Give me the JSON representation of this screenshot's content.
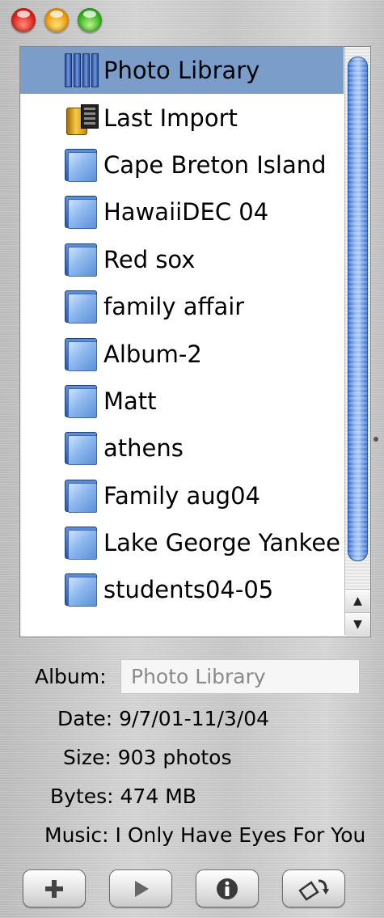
{
  "window": {
    "controls": [
      "close",
      "minimize",
      "zoom"
    ]
  },
  "albums": {
    "items": [
      {
        "label": "Photo Library",
        "icon": "photo-library-icon",
        "selected": true
      },
      {
        "label": "Last Import",
        "icon": "last-import-icon",
        "selected": false
      },
      {
        "label": "Cape Breton Island",
        "icon": "album-folder-icon",
        "selected": false
      },
      {
        "label": "HawaiiDEC 04",
        "icon": "album-folder-icon",
        "selected": false
      },
      {
        "label": "Red sox",
        "icon": "album-folder-icon",
        "selected": false
      },
      {
        "label": "family affair",
        "icon": "album-folder-icon",
        "selected": false
      },
      {
        "label": "Album-2",
        "icon": "album-folder-icon",
        "selected": false
      },
      {
        "label": "Matt",
        "icon": "album-folder-icon",
        "selected": false
      },
      {
        "label": "athens",
        "icon": "album-folder-icon",
        "selected": false
      },
      {
        "label": "Family aug04",
        "icon": "album-folder-icon",
        "selected": false
      },
      {
        "label": "Lake George Yankee",
        "icon": "album-folder-icon",
        "selected": false
      },
      {
        "label": "students04-05",
        "icon": "album-folder-icon",
        "selected": false
      }
    ]
  },
  "info": {
    "album_label": "Album:",
    "album_value": "Photo Library",
    "date_label": "Date:",
    "date_value": "9/7/01-11/3/04",
    "size_label": "Size:",
    "size_value": "903 photos",
    "bytes_label": "Bytes:",
    "bytes_value": "474 MB",
    "music_label": "Music:",
    "music_value": "I Only Have Eyes For You"
  },
  "buttons": {
    "add": "plus-icon",
    "play": "play-icon",
    "info": "info-icon",
    "rotate": "rotate-icon"
  },
  "colors": {
    "selection": "#7a9dc9",
    "scroll_thumb": "#5b8ee0"
  }
}
